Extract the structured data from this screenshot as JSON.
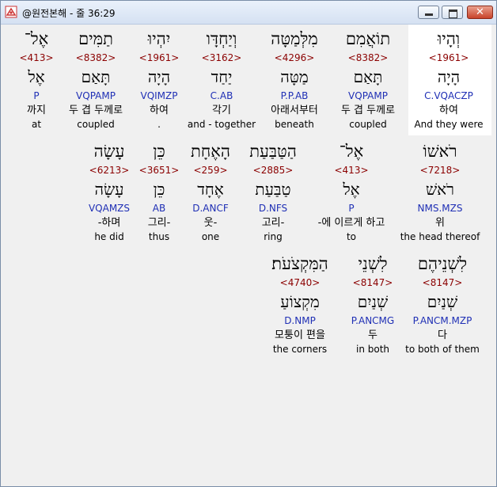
{
  "window": {
    "title": "@원전본해 - 줄 36:29",
    "close_glyph": "✕"
  },
  "rows": [
    [
      {
        "heb": "וְהָיוּ",
        "num": "<1961>",
        "lemma": "הָיָה",
        "code": "C.VQACZP",
        "kor": "하여",
        "eng": "And they were"
      },
      {
        "heb": "תוֹאֲמִם",
        "num": "<8382>",
        "lemma": "תָּאַם",
        "code": "VQPAMP",
        "kor": "두 겹 두께로",
        "eng": "coupled"
      },
      {
        "heb": "מִלְּמַטָּה",
        "num": "<4296>",
        "lemma": "מַטָּה",
        "code": "P.P.AB",
        "kor": "아래서부터",
        "eng": "beneath"
      },
      {
        "heb": "וְיַחְדָּו",
        "num": "<3162>",
        "lemma": "יַחַד",
        "code": "C.AB",
        "kor": "각기",
        "eng": "and - together"
      },
      {
        "heb": "יִהְיוּ",
        "num": "<1961>",
        "lemma": "הָיָה",
        "code": "VQIMZP",
        "kor": "하여",
        "eng": "."
      },
      {
        "heb": "תַמִּים",
        "num": "<8382>",
        "lemma": "תָּאַם",
        "code": "VQPAMP",
        "kor": "두 겹 두께로",
        "eng": "coupled"
      },
      {
        "heb": "אֶל־",
        "num": "<413>",
        "lemma": "אֶל",
        "code": "P",
        "kor": "까지",
        "eng": "at"
      }
    ],
    [
      {
        "heb": "רֹאשׁוֹ",
        "num": "<7218>",
        "lemma": "רֹאשׁ",
        "code": "NMS.MZS",
        "kor": "위",
        "eng": "the head thereof"
      },
      {
        "heb": "אֶל־",
        "num": "<413>",
        "lemma": "אֶל",
        "code": "P",
        "kor": "-에 이르게 하고",
        "eng": "to"
      },
      {
        "heb": "הַטַּבַּעַת",
        "num": "<2885>",
        "lemma": "טַבַּעַת",
        "code": "D.NFS",
        "kor": "고리-",
        "eng": "ring"
      },
      {
        "heb": "הָאֶחָת",
        "num": "<259>",
        "lemma": "אֶחָד",
        "code": "D.ANCF",
        "kor": "웃-",
        "eng": "one"
      },
      {
        "heb": "כֵּן",
        "num": "<3651>",
        "lemma": "כֵּן",
        "code": "AB",
        "kor": "그리-",
        "eng": "thus"
      },
      {
        "heb": "עָשָׂה",
        "num": "<6213>",
        "lemma": "עָשָׂה",
        "code": "VQAMZS",
        "kor": "-하며",
        "eng": "he did"
      }
    ],
    [
      {
        "heb": "לִשְׁנֵיהֶם",
        "num": "<8147>",
        "lemma": "שְׁנַיִם",
        "code": "P.ANCM.MZP",
        "kor": "다",
        "eng": "to both of them"
      },
      {
        "heb": "לִשְׁנֵי",
        "num": "<8147>",
        "lemma": "שְׁנַיִם",
        "code": "P.ANCMG",
        "kor": "두",
        "eng": "in both"
      },
      {
        "heb": "הַמִּקְצֹעֹת׃",
        "num": "<4740>",
        "lemma": "מִקְצוֹעַ",
        "code": "D.NMP",
        "kor": "모퉁이 편을",
        "eng": "the corners"
      }
    ]
  ]
}
